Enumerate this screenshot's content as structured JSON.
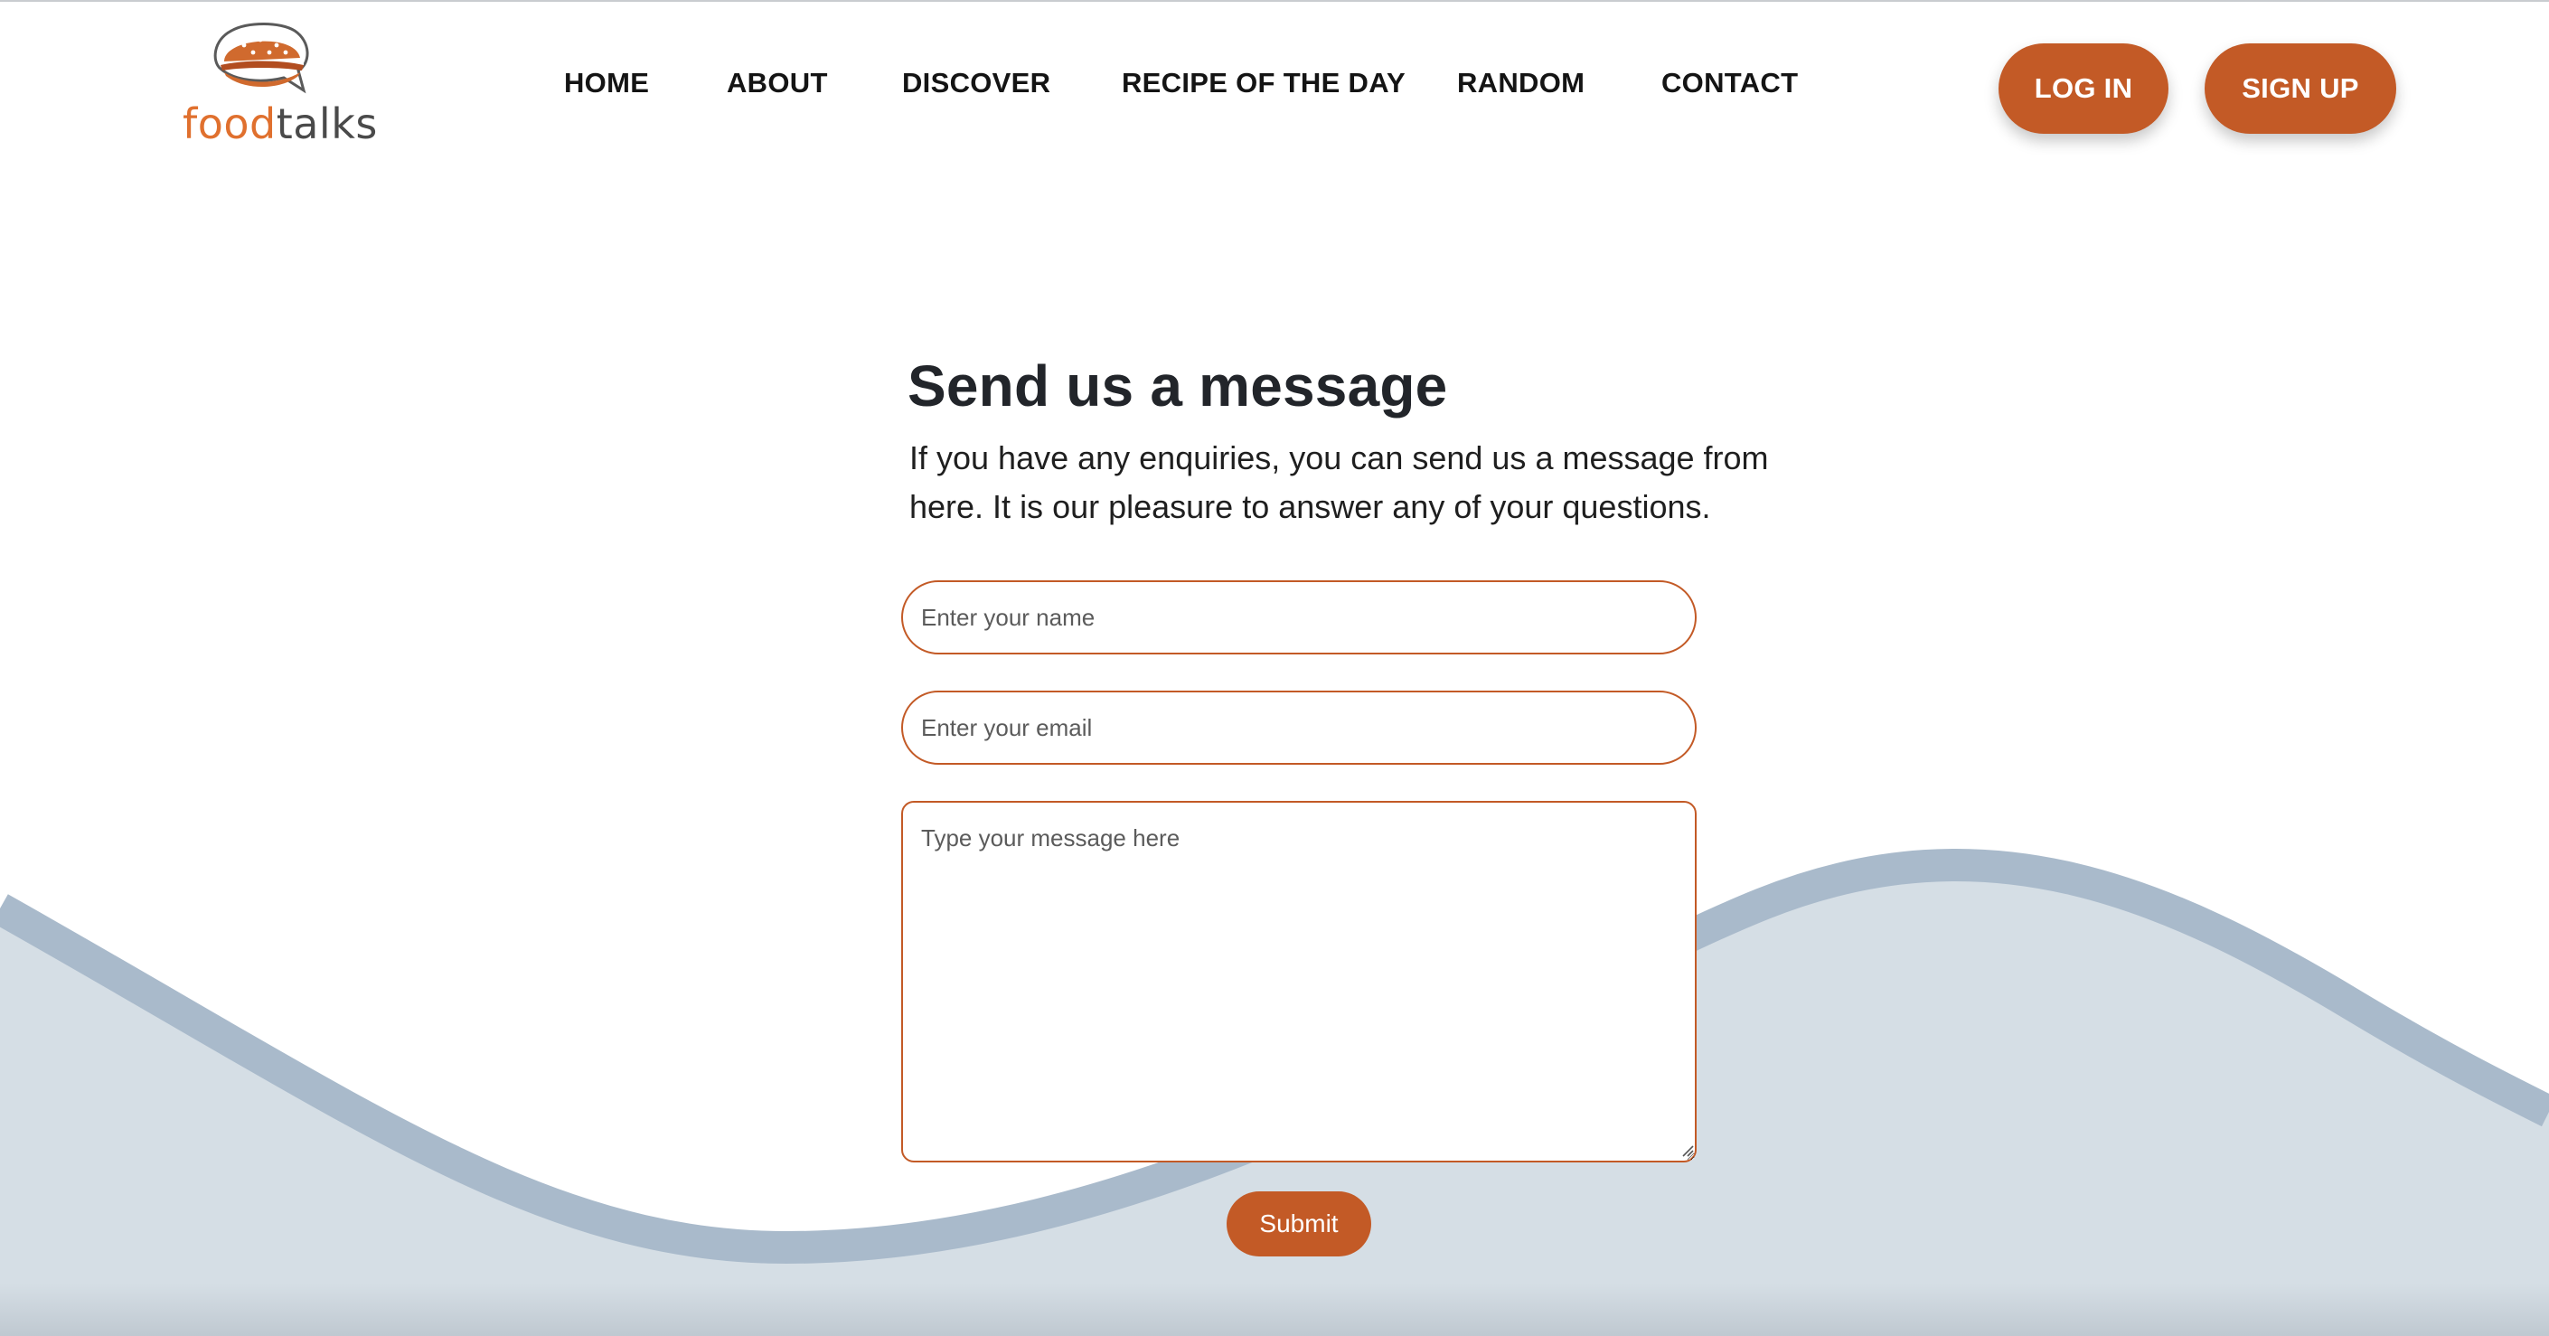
{
  "brand": {
    "name_part1": "food",
    "name_part2": "talks",
    "accent_color": "#c35a26",
    "logo_icon": "burger-speech-bubble-icon"
  },
  "nav": {
    "items": [
      {
        "label": "HOME"
      },
      {
        "label": "ABOUT"
      },
      {
        "label": "DISCOVER"
      },
      {
        "label": "RECIPE OF THE DAY"
      },
      {
        "label": "RANDOM"
      },
      {
        "label": "CONTACT"
      }
    ]
  },
  "auth": {
    "login_label": "LOG IN",
    "signup_label": "SIGN UP"
  },
  "contact": {
    "title": "Send us a message",
    "intro": "If you have any enquiries, you can send us a message from here. It is our pleasure to answer any of your questions.",
    "name_placeholder": "Enter your name",
    "email_placeholder": "Enter your email",
    "message_placeholder": "Type your message here",
    "submit_label": "Submit"
  },
  "colors": {
    "wave_fill": "#d5dee5",
    "wave_stroke": "#a9bacb"
  }
}
